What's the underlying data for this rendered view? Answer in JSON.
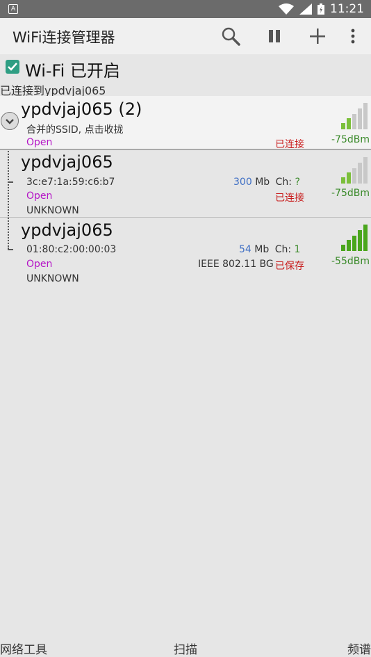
{
  "status_bar": {
    "time": "11:21",
    "notif_glyph": "A"
  },
  "app_bar": {
    "title": "WiFi连接管理器"
  },
  "wifi": {
    "label": "Wi-Fi 已开启",
    "connected_to": "已连接到ypdvjaj065"
  },
  "group": {
    "ssid": "ypdvjaj065 (2)",
    "note": "合并的SSID, 点击收拢",
    "security": "Open",
    "state": "已连接",
    "signal_dbm": "-75dBm",
    "signal_bars_lit": 2
  },
  "networks": [
    {
      "ssid": "ypdvjaj065",
      "bssid": "3c:e7:1a:59:c6:b7",
      "speed": "300",
      "speed_unit": "Mb",
      "ch_label": "Ch:",
      "ch_value": "?",
      "security": "Open",
      "standard": "",
      "state": "已连接",
      "type": "UNKNOWN",
      "signal_dbm": "-75dBm",
      "signal_bars_lit": 2
    },
    {
      "ssid": "ypdvjaj065",
      "bssid": "01:80:c2:00:00:03",
      "speed": "54",
      "speed_unit": "Mb",
      "ch_label": "Ch:",
      "ch_value": "1",
      "security": "Open",
      "standard": "IEEE 802.11 BG",
      "state": "已保存",
      "type": "UNKNOWN",
      "signal_dbm": "-55dBm",
      "signal_bars_lit": 5
    }
  ],
  "bottom_nav": {
    "left": "网络工具",
    "center": "扫描",
    "right": "频谱"
  }
}
